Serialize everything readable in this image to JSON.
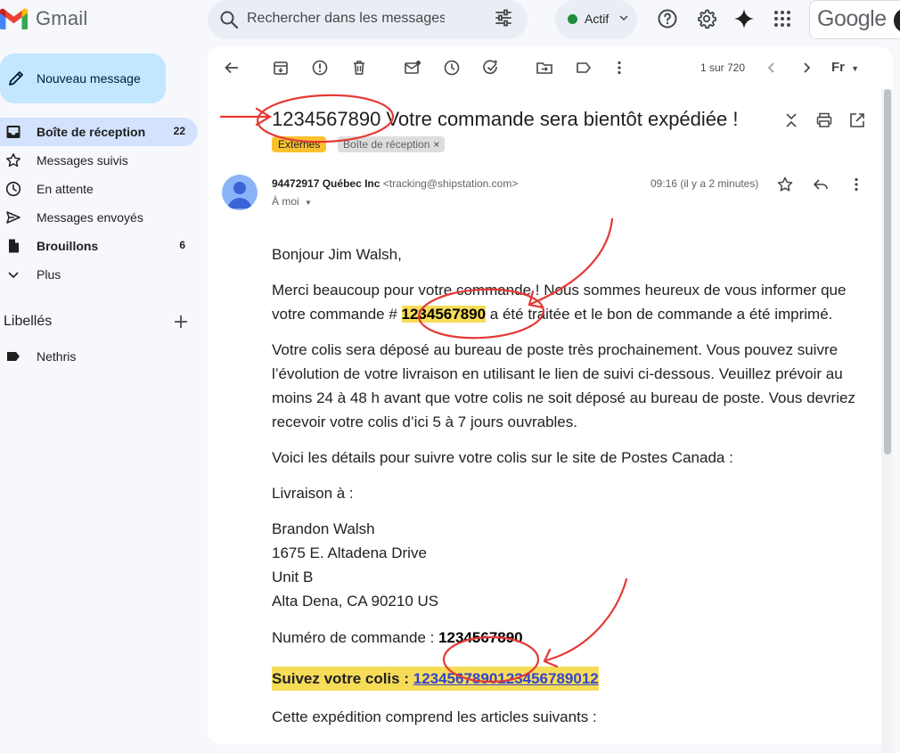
{
  "app": {
    "name": "Gmail"
  },
  "search": {
    "placeholder": "Rechercher dans les messages"
  },
  "status": {
    "label": "Actif",
    "color": "#1e8e3e"
  },
  "account": {
    "brand": "Google"
  },
  "compose": {
    "label": "Nouveau message"
  },
  "sidebar": {
    "items": [
      {
        "label": "Boîte de réception",
        "count": "22",
        "icon": "inbox-icon"
      },
      {
        "label": "Messages suivis",
        "count": "",
        "icon": "star-icon"
      },
      {
        "label": "En attente",
        "count": "",
        "icon": "clock-icon"
      },
      {
        "label": "Messages envoyés",
        "count": "",
        "icon": "send-icon"
      },
      {
        "label": "Brouillons",
        "count": "6",
        "icon": "draft-icon"
      },
      {
        "label": "Plus",
        "count": "",
        "icon": "chevron-down-icon"
      }
    ],
    "labels_heading": "Libellés",
    "labels": [
      {
        "label": "Nethris",
        "icon": "label-icon"
      }
    ]
  },
  "toolbar": {
    "pager": "1 sur 720",
    "lang": "Fr"
  },
  "email": {
    "subject": "1234567890 Votre commande sera bientôt expédiée !",
    "chips": {
      "external": "Externes",
      "inbox": "Boîte de réception"
    },
    "sender_name": "94472917 Québec Inc",
    "sender_email": "<tracking@shipstation.com>",
    "to": "À moi",
    "time": "09:16 (il y a 2 minutes)",
    "greeting": "Bonjour Jim Walsh,",
    "p1_before": "Merci beaucoup pour votre commande ! Nous sommes heureux de vous informer que votre commande # ",
    "order_number": "1234567890",
    "p1_after": " a été traitée et le bon de commande a été imprimé.",
    "p2": "Votre colis sera déposé au bureau de poste très prochainement. Vous pouvez suivre l’évolution de votre livraison en utilisant le lien de suivi ci-dessous. Veuillez prévoir au moins 24 à 48 h avant que votre colis ne soit déposé au bureau de poste. Vous devriez recevoir votre colis d’ici 5 à 7 jours ouvrables.",
    "p3": "Voici les détails pour suivre votre colis sur le site de Postes Canada :",
    "delivery_label": "Livraison à :",
    "address": [
      "Brandon Walsh",
      "1675 E. Altadena Drive",
      "Unit B",
      "Alta Dena, CA 90210 US"
    ],
    "order_label": "Numéro de commande : ",
    "order_number_2": "1234567890",
    "track_label": "Suivez votre colis : ",
    "track_number": "1234567890123456789012",
    "items_intro": "Cette expédition comprend les articles suivants :"
  },
  "colors": {
    "annotation": "#e53935",
    "highlight": "#f7dc58",
    "link": "#3344cc"
  }
}
